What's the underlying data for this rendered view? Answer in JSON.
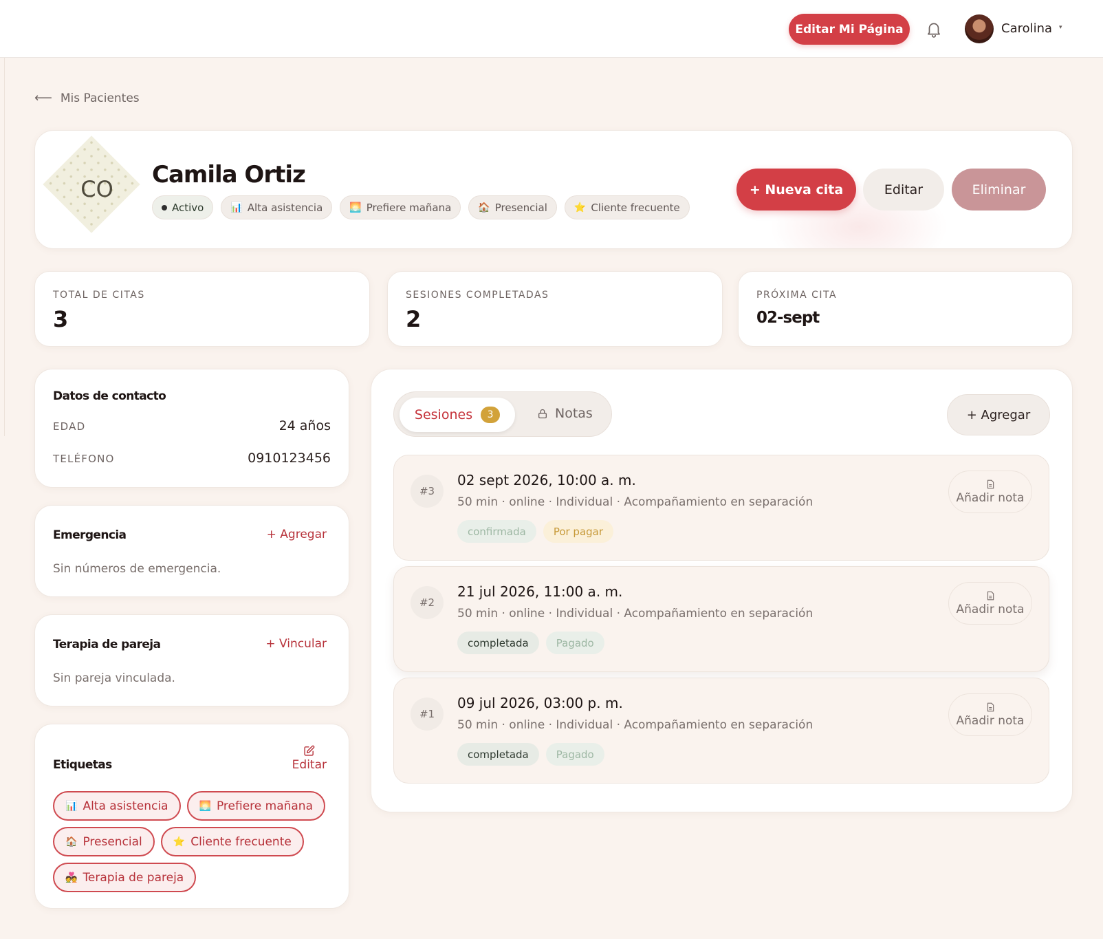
{
  "topbar": {
    "edit_page_label": "Editar Mi Página",
    "user_name": "Carolina",
    "caret": "▾"
  },
  "back": {
    "arrow": "⟵",
    "label": "Mis Pacientes"
  },
  "patient": {
    "initials": "CO",
    "name": "Camila Ortiz",
    "chips": [
      {
        "icon": "",
        "label": "Activo"
      },
      {
        "icon": "📊",
        "label": "Alta asistencia"
      },
      {
        "icon": "🌅",
        "label": "Prefiere mañana"
      },
      {
        "icon": "🏠",
        "label": "Presencial"
      },
      {
        "icon": "⭐",
        "label": "Cliente frecuente"
      }
    ],
    "actions": {
      "new": "+ Nueva cita",
      "edit": "Editar",
      "delete": "Eliminar"
    }
  },
  "stats": [
    {
      "label": "TOTAL DE CITAS",
      "value": "3"
    },
    {
      "label": "SESIONES COMPLETADAS",
      "value": "2"
    },
    {
      "label": "PRÓXIMA CITA",
      "value": "02-sept"
    }
  ],
  "contact": {
    "title": "Datos de contacto",
    "age_label": "EDAD",
    "age_value": "24 años",
    "phone_label": "TELÉFONO",
    "phone_value": "0910123456"
  },
  "emergency": {
    "title": "Emergencia",
    "link": "+ Agregar",
    "empty": "Sin números de emergencia."
  },
  "couple": {
    "title": "Terapia de pareja",
    "link": "+ Vincular",
    "empty": "Sin pareja vinculada."
  },
  "tags": {
    "title": "Etiquetas",
    "edit": "Editar",
    "items": [
      {
        "icon": "📊",
        "label": "Alta asistencia"
      },
      {
        "icon": "🌅",
        "label": "Prefiere mañana"
      },
      {
        "icon": "🏠",
        "label": "Presencial"
      },
      {
        "icon": "⭐",
        "label": "Cliente frecuente"
      },
      {
        "icon": "💑",
        "label": "Terapia de pareja"
      }
    ]
  },
  "tabs": {
    "sessions": "Sesiones",
    "sessions_count": "3",
    "notes": "Notas"
  },
  "add_label": "+ Agregar",
  "sessions": [
    {
      "num": "#3",
      "date": "02 sept 2026, 10:00 a. m.",
      "meta": "50 min · online · Individual · Acompañamiento en separación",
      "status": "confirmada",
      "payment": "Por pagar",
      "note": "Añadir nota"
    },
    {
      "num": "#2",
      "date": "21 jul 2026, 11:00 a. m.",
      "meta": "50 min · online · Individual · Acompañamiento en separación",
      "status": "completada",
      "payment": "Pagado",
      "note": "Añadir nota"
    },
    {
      "num": "#1",
      "date": "09 jul 2026, 03:00 p. m.",
      "meta": "50 min · online · Individual · Acompañamiento en separación",
      "status": "completada",
      "payment": "Pagado",
      "note": "Añadir nota"
    }
  ]
}
